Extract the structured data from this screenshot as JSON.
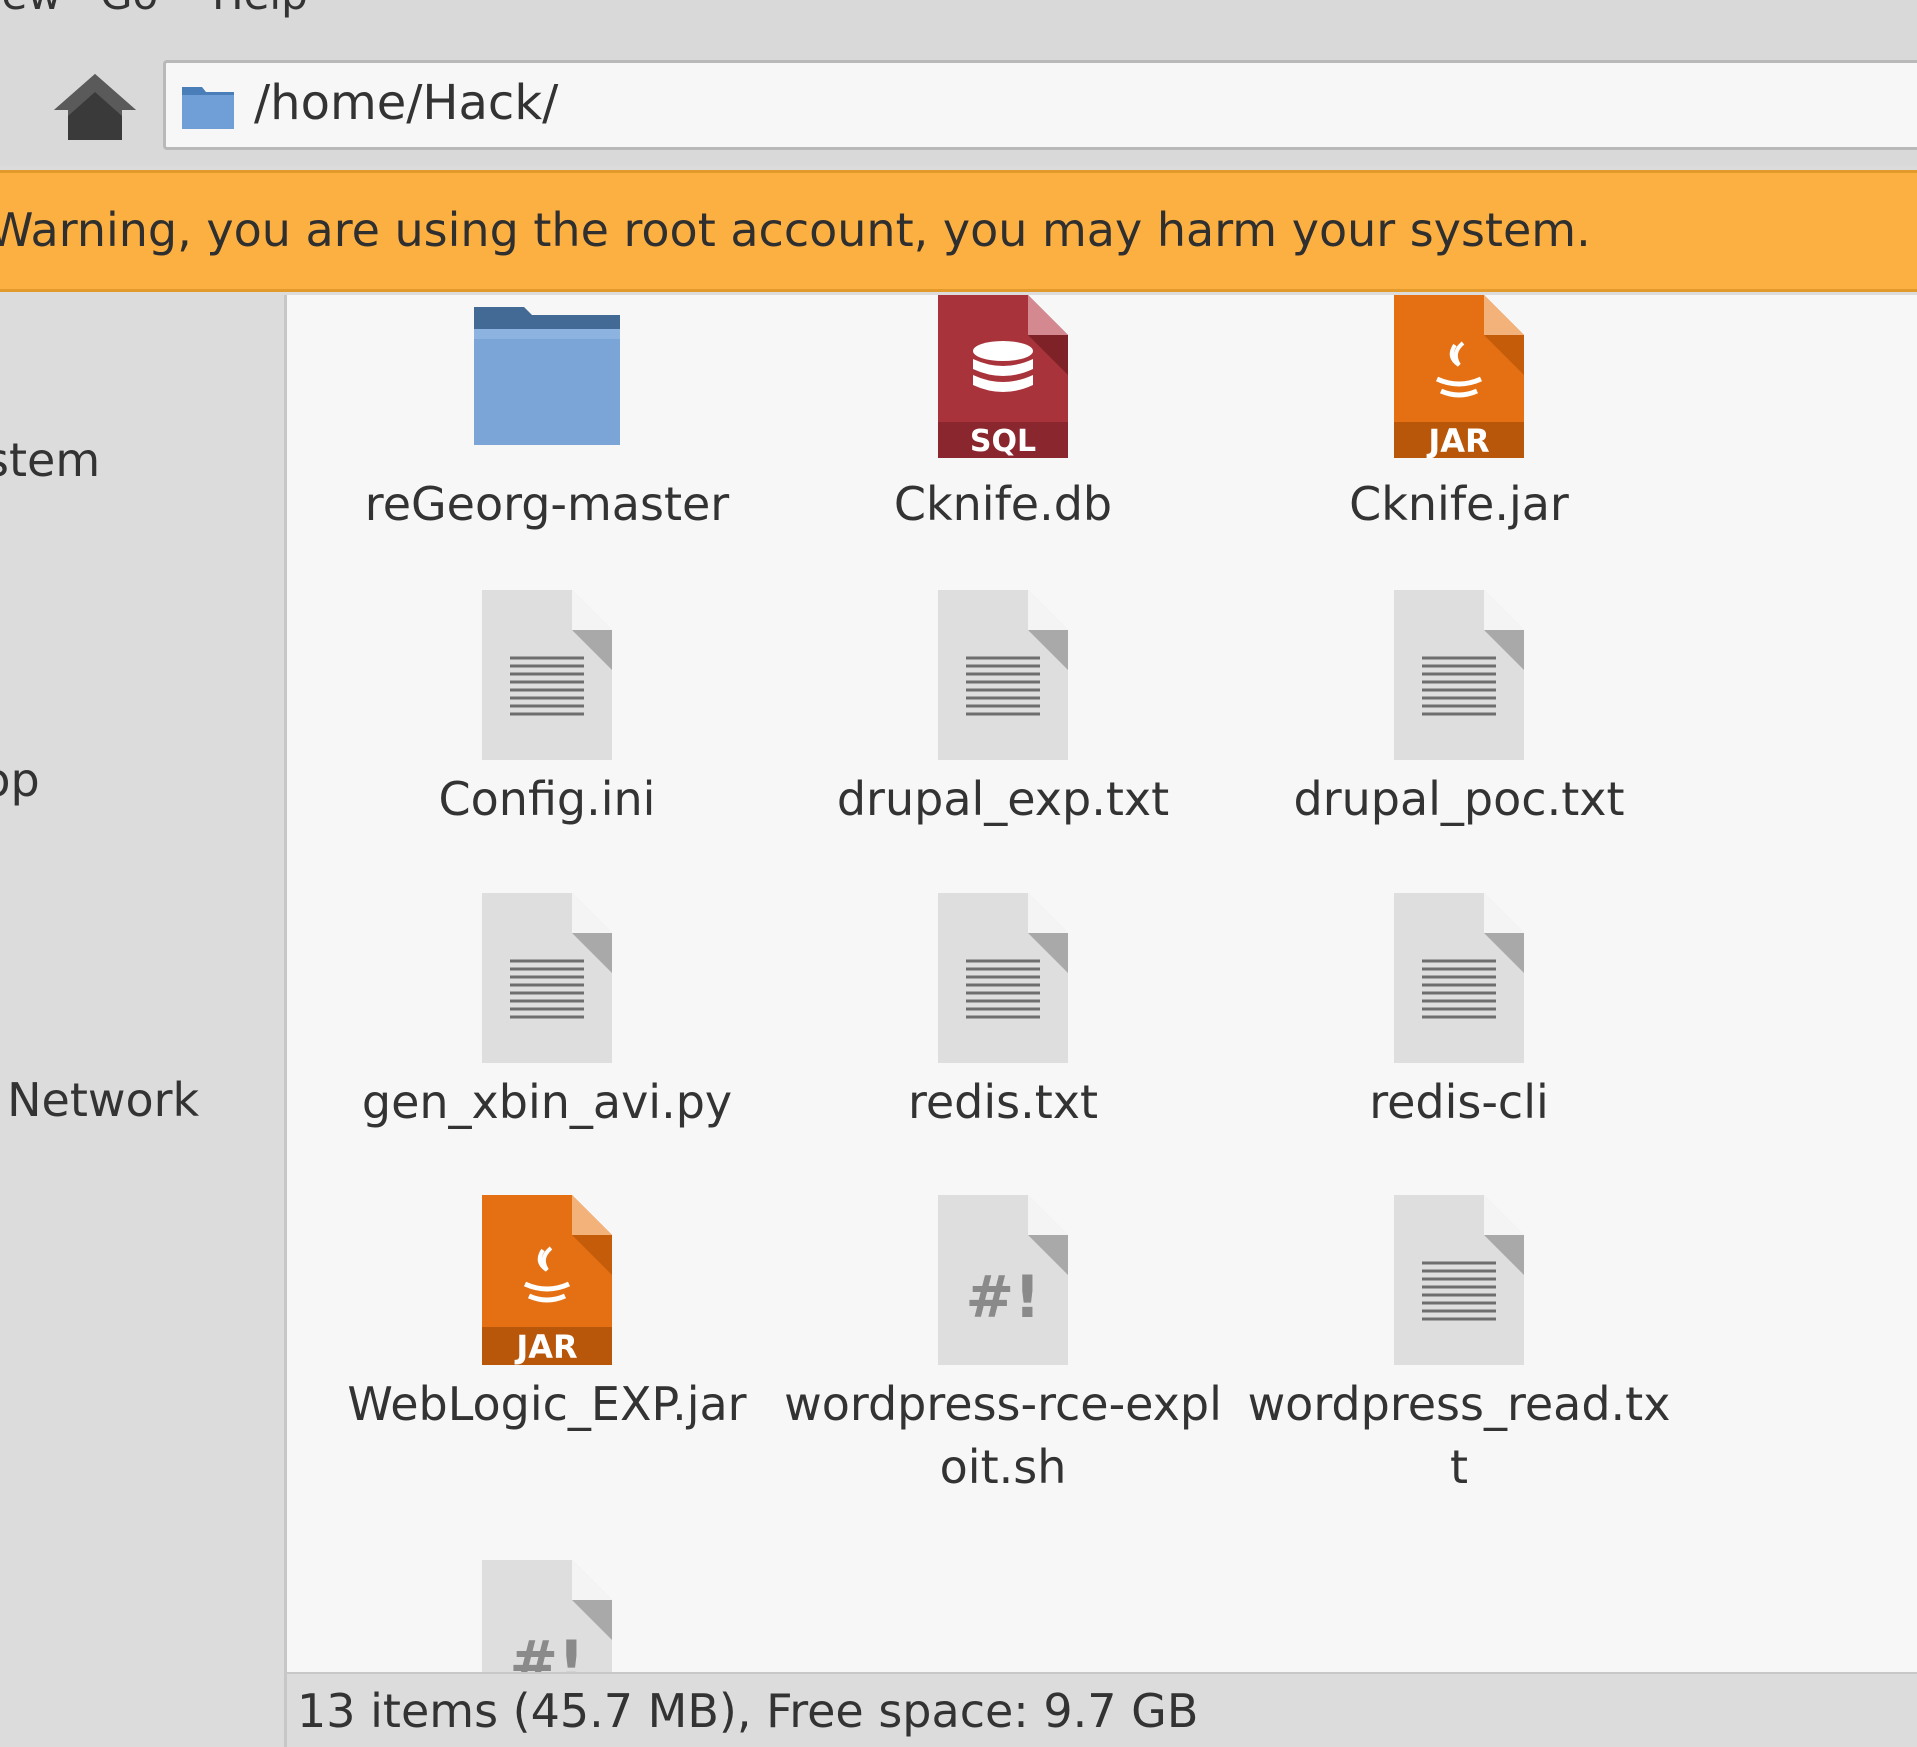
{
  "menu": {
    "view": "View",
    "go": "Go",
    "help": "Help"
  },
  "location": {
    "path": "/home/Hack/"
  },
  "warning": {
    "text": "Warning, you are using the root account, you may harm your system."
  },
  "sidebar": {
    "items": [
      {
        "label": "File System"
      },
      {
        "label": "Desktop"
      },
      {
        "label": "Browse Network"
      }
    ]
  },
  "files": [
    {
      "name": "reGeorg-master",
      "icon": "folder-icon"
    },
    {
      "name": "Cknife.db",
      "icon": "sql-file-icon"
    },
    {
      "name": "Cknife.jar",
      "icon": "jar-file-icon"
    },
    {
      "name": "Config.ini",
      "icon": "text-file-icon"
    },
    {
      "name": "drupal_exp.txt",
      "icon": "text-file-icon"
    },
    {
      "name": "drupal_poc.txt",
      "icon": "text-file-icon"
    },
    {
      "name": "gen_xbin_avi.py",
      "icon": "text-file-icon"
    },
    {
      "name": "redis.txt",
      "icon": "text-file-icon"
    },
    {
      "name": "redis-cli",
      "icon": "text-file-icon"
    },
    {
      "name": "WebLogic_EXP.jar",
      "icon": "jar-file-icon"
    },
    {
      "name": "wordpress-rce-exploit.sh",
      "icon": "script-file-icon"
    },
    {
      "name": "wordpress_read.txt",
      "icon": "text-file-icon"
    },
    {
      "name": "",
      "icon": "script-file-icon"
    }
  ],
  "status": {
    "text": "13 items (45.7 MB), Free space: 9.7 GB"
  },
  "colors": {
    "warning_bg": "#fdb042",
    "folder_blue": "#7aa5d6",
    "sql_red": "#a8333b",
    "jar_orange": "#e47013"
  }
}
